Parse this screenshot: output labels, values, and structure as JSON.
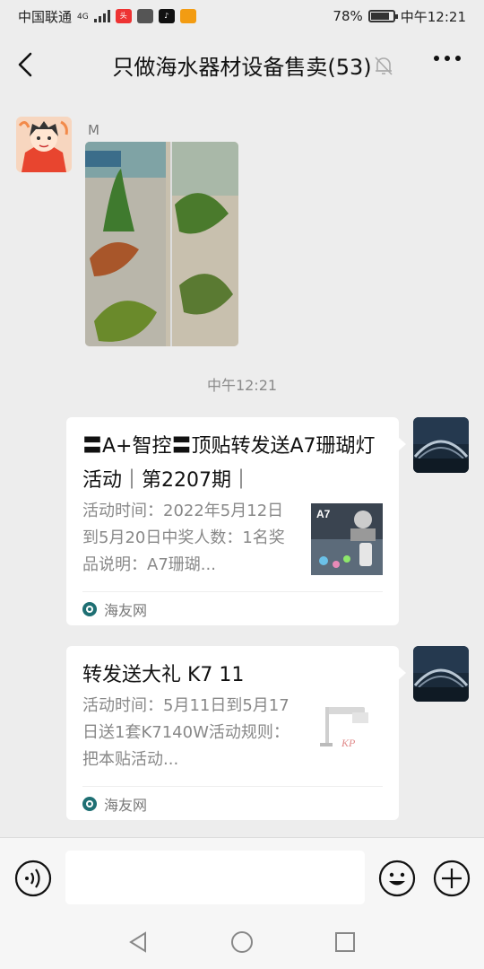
{
  "status_bar": {
    "carrier": "中国联通",
    "network": "4G",
    "battery": "78%",
    "time": "中午12:21"
  },
  "header": {
    "title": "只做海水器材设备售卖(53)"
  },
  "messages": [
    {
      "sender": "M",
      "type": "image"
    }
  ],
  "timestamp": "中午12:21",
  "cards": [
    {
      "title": "〓A+智控〓顶贴转发送A7珊瑚灯活动｜第2207期｜",
      "description": "活动时间：2022年5月12日到5月20日中奖人数：1名奖品说明：A7珊瑚...",
      "source": "海友网",
      "thumb_label": "A7"
    },
    {
      "title": "转发送大礼 K7 11",
      "description": "活动时间：5月11日到5月17日送1套K7140W活动规则：把本贴活动...",
      "source": "海友网",
      "thumb_label": "KP"
    }
  ],
  "input": {
    "placeholder": ""
  }
}
